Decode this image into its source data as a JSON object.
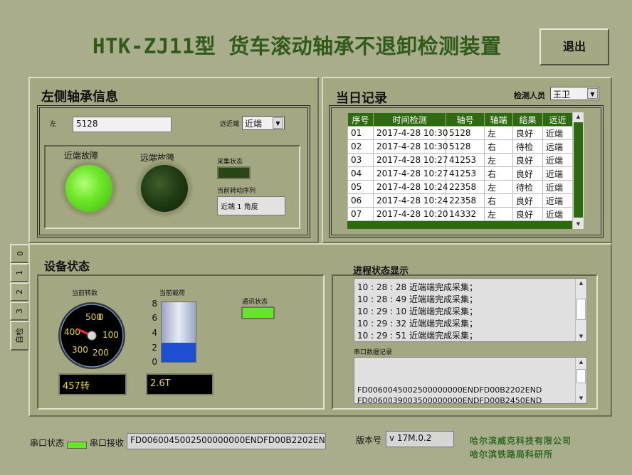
{
  "header": {
    "title": "HTK-ZJ11型 货车滚动轴承不退卸检测装置",
    "exit_label": "退出"
  },
  "left_bearing": {
    "title": "左侧轴承信息",
    "side_label": "左",
    "side_value": "5128",
    "near_far_label": "远近端",
    "near_far_value": "近端",
    "near_fault_label": "近端故障",
    "far_fault_label": "远端故障",
    "collect_status_label": "采集状态",
    "rotation_seq_label": "当前转动序列",
    "rotation_seq_value": "近端 1 角度"
  },
  "daily_record": {
    "title": "当日记录",
    "inspector_label": "检测人员",
    "inspector_value": "王卫",
    "columns": [
      "序号",
      "时间检测",
      "轴号",
      "轴端",
      "结果",
      "远近"
    ],
    "rows": [
      [
        "01",
        "2017-4-28 10:30",
        "5128",
        "左",
        "良好",
        "近端"
      ],
      [
        "02",
        "2017-4-28 10:30",
        "5128",
        "右",
        "待检",
        "远端"
      ],
      [
        "03",
        "2017-4-28 10:27",
        "41253",
        "左",
        "良好",
        "近端"
      ],
      [
        "04",
        "2017-4-28 10:27",
        "41253",
        "右",
        "良好",
        "近端"
      ],
      [
        "05",
        "2017-4-28 10:24",
        "22358",
        "左",
        "待检",
        "近端"
      ],
      [
        "06",
        "2017-4-28 10:24",
        "22358",
        "右",
        "良好",
        "近端"
      ],
      [
        "07",
        "2017-4-28 10:20",
        "14332",
        "左",
        "良好",
        "近端"
      ]
    ]
  },
  "tabs": [
    "0",
    "1",
    "2",
    "3",
    "自检"
  ],
  "device_status": {
    "title": "设备状态",
    "speed_label": "当前转数",
    "gauge_ticks": [
      "500",
      "0",
      "400",
      "100",
      "300",
      "200"
    ],
    "speed_value": "457转",
    "speed_reading": 457,
    "load_label": "当前载荷",
    "load_ticks": [
      "8",
      "6",
      "4",
      "2",
      "0"
    ],
    "load_value": "2.6T",
    "load_reading": 2.6,
    "comm_label": "通讯状态"
  },
  "process": {
    "title": "进程状态显示",
    "lines": [
      "10 : 28 : 28 近端端完成采集；",
      "10 : 28 : 49 近端端完成采集；",
      "10 : 29 : 10 近端端完成采集；",
      "10 : 29 : 32 近端端完成采集；",
      "10 : 29 : 51 近端端完成采集；"
    ],
    "serial_log_label": "串口数据记录",
    "serial_lines": [
      "FD0060045002500000000ENDFD00B2202END",
      "FD0060039003500000000ENDFD00B2450END"
    ]
  },
  "footer": {
    "serial_status_label": "串口状态",
    "serial_recv_label": "串口接收",
    "serial_recv_value": "FD0060045002500000000ENDFD00B2202EN",
    "version_label": "版本号",
    "version_value": "v 17M.0.2",
    "company1": "哈尔滨威克科技有限公司",
    "company2": "哈尔滨铁路局科研所"
  },
  "colors": {
    "led_on": "#6fe82a",
    "led_off": "#1f3b12",
    "title_green": "#2f5b18",
    "table_header": "#2e6a10"
  }
}
